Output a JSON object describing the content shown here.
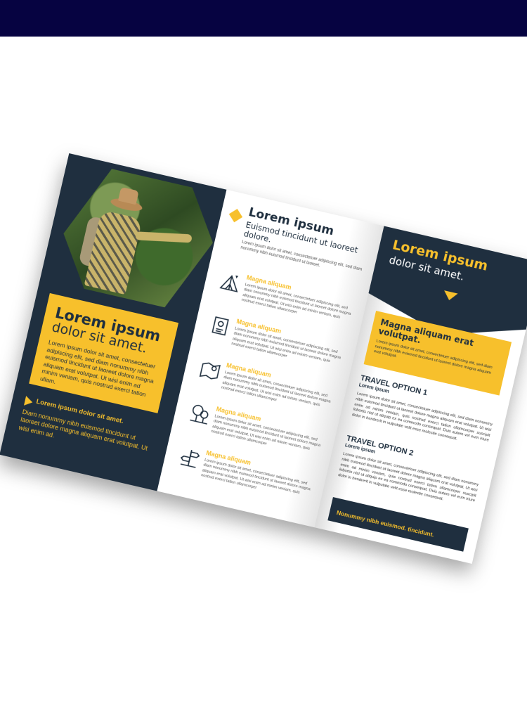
{
  "brochure": {
    "panel1": {
      "headline": "Lorem ipsum",
      "subheadline": "dolor sit amet.",
      "body": "Lorem ipsum dolor sit amet, consectetuer adipiscing elit, sed diam nonummy nibh euismod tincidunt ut laoreet dolore magna aliquam erat volutpat. Ut wisi enim ad minim veniam, quis nostrud exerci tation ullam.",
      "note_title": "Lorem ipsum dolor sit amet.",
      "note_text": "Diam nonummy nibh euismod tincidunt ut laoreet dolore magna aliquam erat volutpat. Ut wisi enim ad."
    },
    "panel2": {
      "title": "Lorem ipsum",
      "subtitle": "Euismod tincidunt ut laoreet dolore.",
      "intro": "Lorem ipsum dolor sit amet, consectetuer adipiscing elit, sed diam nonummy nibh euismod tincidunt ut laoreet.",
      "features": [
        {
          "icon": "tent-icon",
          "title": "Magna aliquam",
          "text": "Lorem ipsum dolor sit amet, consectetuer adipiscing elit, sed diam nonummy nibh euismod tincidunt ut laoreet dolore magna aliquam erat volutpat. Ut wisi enim ad minim veniam, quis nostrud exerci tation ullamcorper"
        },
        {
          "icon": "map-book-icon",
          "title": "Magna aliquam",
          "text": "Lorem ipsum dolor sit amet, consectetuer adipiscing elit, sed diam nonummy nibh euismod tincidunt ut laoreet dolore magna aliquam erat volutpat. Ut wisi enim ad minim veniam, quis nostrud exerci tation ullamcorper"
        },
        {
          "icon": "map-pin-icon",
          "title": "Magna aliquam",
          "text": "Lorem ipsum dolor sit amet, consectetuer adipiscing elit, sed diam nonummy nibh euismod tincidunt ut laoreet dolore magna aliquam erat volutpat. Ut wisi enim ad minim veniam, quis nostrud exerci tation ullamcorper"
        },
        {
          "icon": "trees-icon",
          "title": "Magna aliquam",
          "text": "Lorem ipsum dolor sit amet, consectetuer adipiscing elit, sed diam nonummy nibh euismod tincidunt ut laoreet dolore magna aliquam erat volutpat. Ut wisi enim ad minim veniam, quis nostrud exerci tation ullamcorper"
        },
        {
          "icon": "signpost-icon",
          "title": "Magna aliquam",
          "text": "Lorem ipsum dolor sit amet, consectetuer adipiscing elit, sed diam nonummy nibh euismod tincidunt ut laoreet dolore magna aliquam erat volutpat. Ut wisi enim ad minim veniam, quis nostrud exerci tation ullamcorper"
        }
      ]
    },
    "panel3": {
      "title": "Lorem ipsum",
      "subtitle": "dolor sit amet.",
      "highlight_title": "Magna aliquam erat volutpat.",
      "highlight_text": "Lorem ipsum dolor sit amet, consectetuer adipiscing elit, sed diam nonummy nibh euismod tincidunt ut laoreet dolore magna aliquam erat volutpat.",
      "options": [
        {
          "title": "TRAVEL OPTION 1",
          "subtitle": "Lorem ipsum",
          "text": "Lorem ipsum dolor sit amet, consectetuer adipiscing elit, sed diam nonummy nibh euismod tincidunt ut laoreet dolore magna aliquam erat volutpat. Ut wisi enim ad minim veniam, quis nostrud exerci tation ullamcorper suscipit lobortis nisl ut aliquip ex ea commodo consequat. Duis autem vel eum iriure dolor in hendrerit in vulputate velit esse molestie consequat."
        },
        {
          "title": "TRAVEL OPTION 2",
          "subtitle": "Lorem ipsum",
          "text": "Lorem ipsum dolor sit amet, consectetuer adipiscing elit, sed diam nonummy nibh euismod tincidunt ut laoreet dolore magna aliquam erat volutpat. Ut wisi enim ad minim veniam, quis nostrud exerci tation ullamcorper suscipit lobortis nisl ut aliquip ex ea commodo consequat. Duis autem vel eum iriure dolor in hendrerit in vulputate velit esse molestie consequat."
        }
      ],
      "footer": "Nonummy nibh euismod. tincidunt."
    }
  },
  "colors": {
    "navy": "#1f2f3f",
    "yellow": "#f7c02c",
    "topbar": "#060341"
  }
}
